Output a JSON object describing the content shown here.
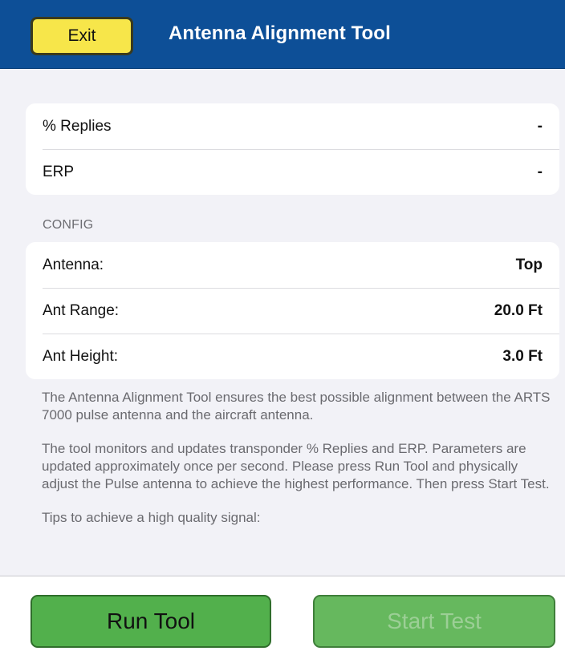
{
  "header": {
    "exit_label": "Exit",
    "title": "Antenna Alignment Tool"
  },
  "results": [
    {
      "label": "% Replies",
      "value": "-"
    },
    {
      "label": "ERP",
      "value": "-"
    }
  ],
  "config": {
    "section_title": "CONFIG",
    "rows": [
      {
        "label": "Antenna:",
        "value": "Top"
      },
      {
        "label": "Ant Range:",
        "value": "20.0 Ft"
      },
      {
        "label": "Ant Height:",
        "value": "3.0 Ft"
      }
    ]
  },
  "info": {
    "paragraph_1": "The Antenna Alignment Tool ensures the best possible alignment between the ARTS 7000 pulse antenna and the aircraft antenna.",
    "paragraph_2": "The tool monitors and updates transponder % Replies and ERP. Parameters are updated approximately once per second. Please press Run Tool and physically adjust the Pulse antenna to achieve the highest performance. Then press Start Test.",
    "paragraph_3": "Tips to achieve a high quality signal:"
  },
  "footer": {
    "run_label": "Run Tool",
    "start_label": "Start Test",
    "start_enabled": false
  },
  "colors": {
    "header_bg": "#0d4f97",
    "exit_button": "#f7e64a",
    "action_green": "#52b04c",
    "disabled_text": "#9ccf96"
  }
}
